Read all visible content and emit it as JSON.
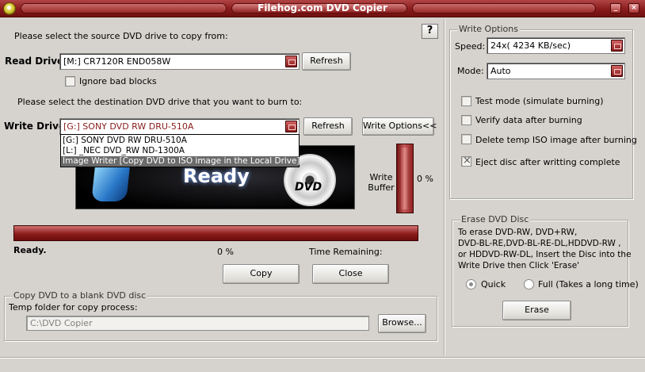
{
  "window": {
    "title": "Filehog.com DVD Copier",
    "minimize_label": "_",
    "close_label": "×"
  },
  "source": {
    "prompt": "Please select the source DVD drive to copy from:",
    "read_drive_label": "Read Drive:",
    "read_drive_value": "[M:] CR7120R  END058W",
    "refresh_label": "Refresh",
    "ignore_bad_blocks_label": "Ignore bad blocks",
    "ignore_bad_blocks_checked": false
  },
  "destination": {
    "prompt": "Please select the destination DVD drive that you want to burn to:",
    "write_drive_label": "Write Drive:",
    "write_drive_value": "[G:] SONY     DVD RW DRU-510A",
    "refresh_label": "Refresh",
    "write_options_label": "Write Options<<",
    "dropdown_options": [
      "[G:] SONY     DVD RW DRU-510A",
      "[L:] _NEC     DVD_RW ND-1300A",
      "Image Writer [Copy DVD to ISO image in the Local Drive]"
    ],
    "dropdown_selected_index": 2
  },
  "status": {
    "banner_text": "Ready",
    "disc_logo": "DVD",
    "write_buffer_label_1": "Write",
    "write_buffer_label_2": "Buffer",
    "write_buffer_percent": "0 %",
    "status_text": "Ready.",
    "progress_percent": "0 %",
    "progress_value": 0,
    "time_remaining_label": "Time Remaining:"
  },
  "actions": {
    "copy_label": "Copy",
    "close_label": "Close",
    "help_label": "?"
  },
  "blank_disc": {
    "group_title": "Copy DVD to a blank DVD disc",
    "temp_folder_label": "Temp folder for copy process:",
    "temp_folder_value": "C:\\DVD Copier",
    "browse_label": "Browse..."
  },
  "write_options": {
    "group_title": "Write Options",
    "speed_label": "Speed:",
    "speed_value": "24x( 4234 KB/sec)",
    "mode_label": "Mode:",
    "mode_value": "Auto",
    "checkboxes": [
      {
        "label": "Test mode (simulate burning)",
        "checked": false
      },
      {
        "label": "Verify data after burning",
        "checked": false
      },
      {
        "label": "Delete temp ISO image after burning",
        "checked": false
      },
      {
        "label": "Eject disc after writting complete",
        "checked": true
      }
    ]
  },
  "erase": {
    "group_title": "Erase DVD Disc",
    "instructions_1": "To erase DVD-RW, DVD+RW,",
    "instructions_2": "DVD-BL-RE,DVD-BL-RE-DL,HDDVD-RW ,",
    "instructions_3": "or HDDVD-RW-DL, Insert the Disc into the",
    "instructions_4": "Write Drive then Click 'Erase'",
    "quick_label": "Quick",
    "full_label": "Full (Takes a long time)",
    "selected": "quick",
    "erase_label": "Erase"
  }
}
